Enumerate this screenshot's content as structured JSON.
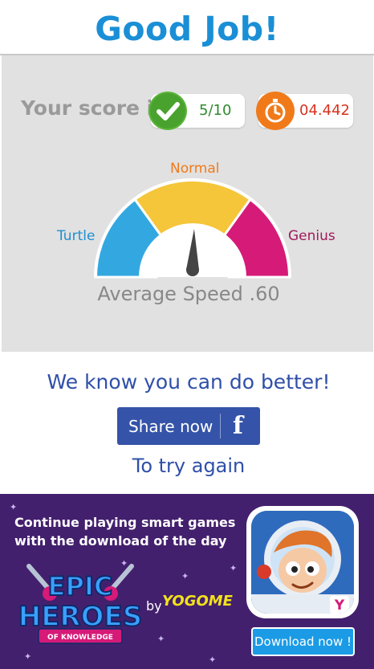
{
  "header": {
    "title": "Good Job!"
  },
  "results": {
    "score_label": "Your score is",
    "score_value": "5/10",
    "time_value": "04.442",
    "colors": {
      "score": "#2f8a2f",
      "time": "#d8321e",
      "check_badge": "#5bb53a",
      "timer_badge": "#f07a1a"
    }
  },
  "gauge": {
    "labels": {
      "left": "Turtle",
      "top": "Normal",
      "right": "Genius"
    },
    "average_text": "Average Speed .60",
    "needle_value": 0.6,
    "colors": {
      "left": "#33a8e0",
      "middle": "#f5c53a",
      "right": "#d61a78",
      "needle": "#444444"
    }
  },
  "feedback": {
    "message": "We know you can do better!",
    "share_label": "Share now",
    "share_icon": "facebook-f",
    "retry_label": "To try again"
  },
  "promo": {
    "line1": "Continue playing smart games",
    "line2": "with the download of the day",
    "game_title_line1": "EPIC",
    "game_title_line2": "HEROES",
    "game_subtitle": "OF KNOWLEDGE",
    "by_text": "by",
    "brand": "YOGOME",
    "download_label": "Download now !",
    "badge_letter": "Y"
  }
}
